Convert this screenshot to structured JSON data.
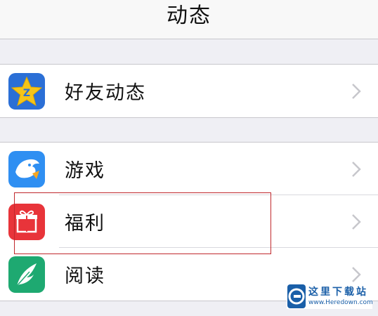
{
  "header": {
    "title": "动态"
  },
  "groups": [
    {
      "items": [
        {
          "label": "好友动态",
          "icon": "qzone-star-icon",
          "color": "#f5c518"
        }
      ]
    },
    {
      "items": [
        {
          "label": "游戏",
          "icon": "game-shark-icon",
          "color": "#2f8ff2"
        },
        {
          "label": "福利",
          "icon": "gift-icon",
          "color": "#e8343a"
        },
        {
          "label": "阅读",
          "icon": "feather-book-icon",
          "color": "#1ea971"
        }
      ]
    }
  ],
  "watermark": {
    "name": "这里下载站",
    "url": "www.Heredown.com",
    "color": "#1a5fa8"
  },
  "highlight": {
    "color": "#c0282d",
    "target": "福利"
  }
}
